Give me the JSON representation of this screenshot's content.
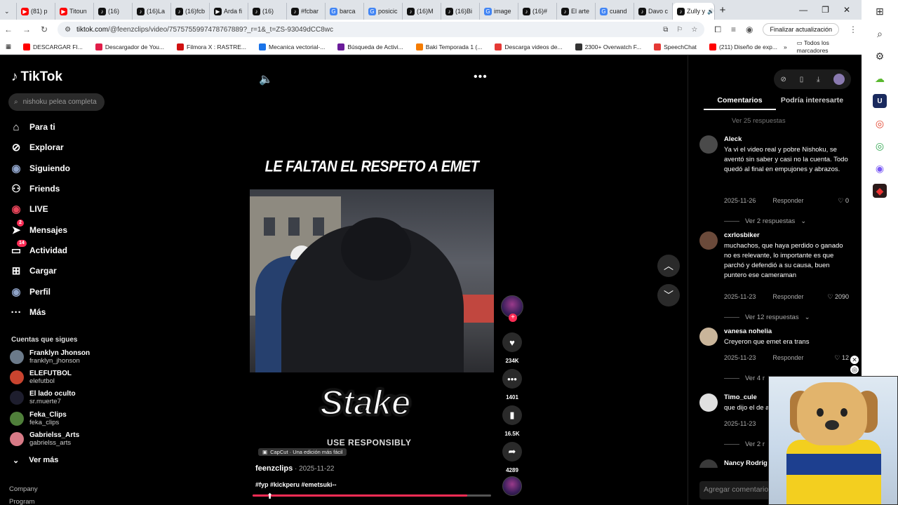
{
  "browser": {
    "tabs": [
      {
        "label": "(81) p",
        "icon": "youtube-icon",
        "color": "#ff0000"
      },
      {
        "label": "Titoun",
        "icon": "youtube-icon",
        "color": "#ff0000"
      },
      {
        "label": "(16)",
        "icon": "tiktok-icon",
        "color": "#111111"
      },
      {
        "label": "(16)La",
        "icon": "tiktok-icon",
        "color": "#111111"
      },
      {
        "label": "(16)fcb",
        "icon": "tiktok-icon",
        "color": "#111111"
      },
      {
        "label": "Arda fi",
        "icon": "capcut-icon",
        "color": "#111111"
      },
      {
        "label": "(16)",
        "icon": "tiktok-icon",
        "color": "#111111"
      },
      {
        "label": "#fcbar",
        "icon": "tiktok-icon",
        "color": "#111111"
      },
      {
        "label": "barca",
        "icon": "google-icon",
        "color": "#4285f4"
      },
      {
        "label": "posicic",
        "icon": "google-icon",
        "color": "#4285f4"
      },
      {
        "label": "(16)M",
        "icon": "tiktok-icon",
        "color": "#111111"
      },
      {
        "label": "(16)Bi",
        "icon": "tiktok-icon",
        "color": "#111111"
      },
      {
        "label": "image",
        "icon": "google-icon",
        "color": "#4285f4"
      },
      {
        "label": "(16)#",
        "icon": "tiktok-icon",
        "color": "#111111"
      },
      {
        "label": "El arte",
        "icon": "tiktok-icon",
        "color": "#111111"
      },
      {
        "label": "cuand",
        "icon": "google-icon",
        "color": "#4285f4"
      },
      {
        "label": "Davo c",
        "icon": "tiktok-icon",
        "color": "#111111"
      },
      {
        "label": "Zully y",
        "icon": "tiktok-icon",
        "color": "#111111"
      }
    ],
    "url_domain": "tiktok.com",
    "url_path": "/@feenzclips/video/7575755997478767889?_r=1&_t=ZS-93049dCC8wc",
    "update_button": "Finalizar actualización",
    "bookmarks": [
      {
        "label": "DESCARGAR FI...",
        "color": "#ff0000"
      },
      {
        "label": "Descargador de You...",
        "color": "#e11d48"
      },
      {
        "label": "Filmora X : RASTRE...",
        "color": "#d01010"
      },
      {
        "label": "Mecanica vectorial-...",
        "color": "#1a73e8"
      },
      {
        "label": "Búsqueda de Activi...",
        "color": "#6a1b9a"
      },
      {
        "label": "Baki Temporada 1 (...",
        "color": "#f57c00"
      },
      {
        "label": "Descarga videos de...",
        "color": "#e53935"
      },
      {
        "label": "2300+ Overwatch F...",
        "color": "#333333"
      },
      {
        "label": "SpeechChat",
        "color": "#e53935"
      },
      {
        "label": "(211) Diseño de exp...",
        "color": "#ff0000"
      }
    ],
    "all_bookmarks": "Todos los marcadores"
  },
  "tiktok": {
    "logo": "TikTok",
    "search_placeholder": "nishoku pelea completa",
    "nav": [
      {
        "label": "Para ti",
        "icon": "home-icon"
      },
      {
        "label": "Explorar",
        "icon": "compass-icon"
      },
      {
        "label": "Siguiendo",
        "icon": "following-icon"
      },
      {
        "label": "Friends",
        "icon": "friends-icon"
      },
      {
        "label": "LIVE",
        "icon": "live-icon"
      },
      {
        "label": "Mensajes",
        "icon": "send-icon",
        "badge": "2"
      },
      {
        "label": "Actividad",
        "icon": "inbox-icon",
        "badge": "14"
      },
      {
        "label": "Cargar",
        "icon": "upload-icon"
      },
      {
        "label": "Perfil",
        "icon": "profile-icon"
      },
      {
        "label": "Más",
        "icon": "more-icon"
      }
    ],
    "following_title": "Cuentas que sigues",
    "following": [
      {
        "name": "Franklyn Jhonson",
        "handle": "franklyn_jhonson",
        "color": "#6b7a8a"
      },
      {
        "name": "ELEFUTBOL",
        "handle": "elefutbol",
        "color": "#c9442f"
      },
      {
        "name": "El lado oculto",
        "handle": "sr.muerte7",
        "color": "#1e1e2e"
      },
      {
        "name": "Feka_Clips",
        "handle": "feka_clips",
        "color": "#4f7f3a"
      },
      {
        "name": "Gabrielss_Arts",
        "handle": "gabrielss_arts",
        "color": "#d77a86"
      }
    ],
    "see_more": "Ver más",
    "company": "Company",
    "program": "Program"
  },
  "video": {
    "headline": "LE FALTAN EL RESPETO A EMET",
    "sponsor": "Stake",
    "sponsor_sub": "USE RESPONSIBLY",
    "capcut": "CapCut · Una edición más fácil",
    "author": "feenzclips",
    "date": " · 2025-11-22",
    "tags": "#fyp #kickperu #emetsuki--",
    "progress": 0.9,
    "likes": "234K",
    "comments": "1401",
    "saves": "16.5K",
    "shares": "4289"
  },
  "comments_panel": {
    "tab_comments": "Comentarios",
    "tab_interest": "Podría interesarte",
    "add_placeholder": "Agregar comentario...",
    "partial_top": "Ver 25 respuestas",
    "items": [
      {
        "user": "Aleck",
        "text": "Ya vi el video real y pobre Nishoku, se aventó sin saber y casi no la cuenta. Todo quedó al final en empujones y abrazos.",
        "date": "2025-11-26",
        "reply": "Responder",
        "likes": "0",
        "replies": "Ver 2 respuestas"
      },
      {
        "user": "cxrlosbiker",
        "text": "muchachos, que haya perdido o ganado no es relevante, lo importante es que parchó y defendió a su causa, buen puntero ese cameraman",
        "date": "2025-11-23",
        "reply": "Responder",
        "likes": "2090",
        "replies": "Ver 12 respuestas"
      },
      {
        "user": "vanesa nohelia",
        "text": "Creyeron que emet era trans",
        "date": "2025-11-23",
        "reply": "Responder",
        "likes": "12",
        "replies": "Ver 4 r"
      },
      {
        "user": "Timo_cule",
        "text": "que dijo el de a",
        "date": "2025-11-23",
        "reply": "",
        "likes": "",
        "replies": "Ver 2 r"
      },
      {
        "user": "Nancy Rodríg",
        "text": "",
        "date": "",
        "reply": "",
        "likes": "",
        "replies": ""
      }
    ]
  }
}
